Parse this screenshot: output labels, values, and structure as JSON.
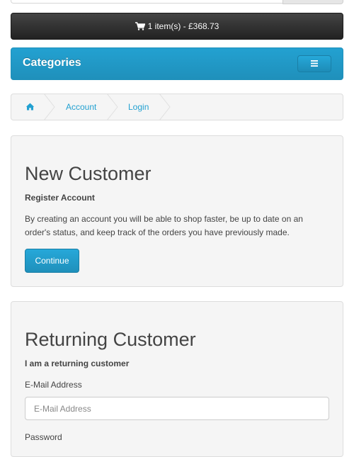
{
  "search": {
    "input_placeholder": "",
    "button_label": ""
  },
  "cart": {
    "label": "1 item(s) - £368.73",
    "icon": "shopping-cart-icon"
  },
  "menu": {
    "title": "Categories",
    "toggle_icon": "bars-icon"
  },
  "breadcrumb": {
    "home_icon": "home-icon",
    "items": [
      {
        "label": "Account"
      },
      {
        "label": "Login"
      }
    ]
  },
  "new_customer": {
    "heading": "New Customer",
    "subheading": "Register Account",
    "description_line1": "By creating an account you will be able to shop faster, be up to date on an",
    "description_line2": "order's status, and keep track of the orders you have previously made.",
    "button_label": "Continue"
  },
  "returning_customer": {
    "heading": "Returning Customer",
    "subheading": "I am a returning customer",
    "email_label": "E-Mail Address",
    "email_placeholder": "E-Mail Address",
    "email_value": "",
    "password_label": "Password"
  },
  "colors": {
    "accent": "#23a1d1",
    "cart_bar": "#333333",
    "panel_bg": "#f5f5f5"
  }
}
